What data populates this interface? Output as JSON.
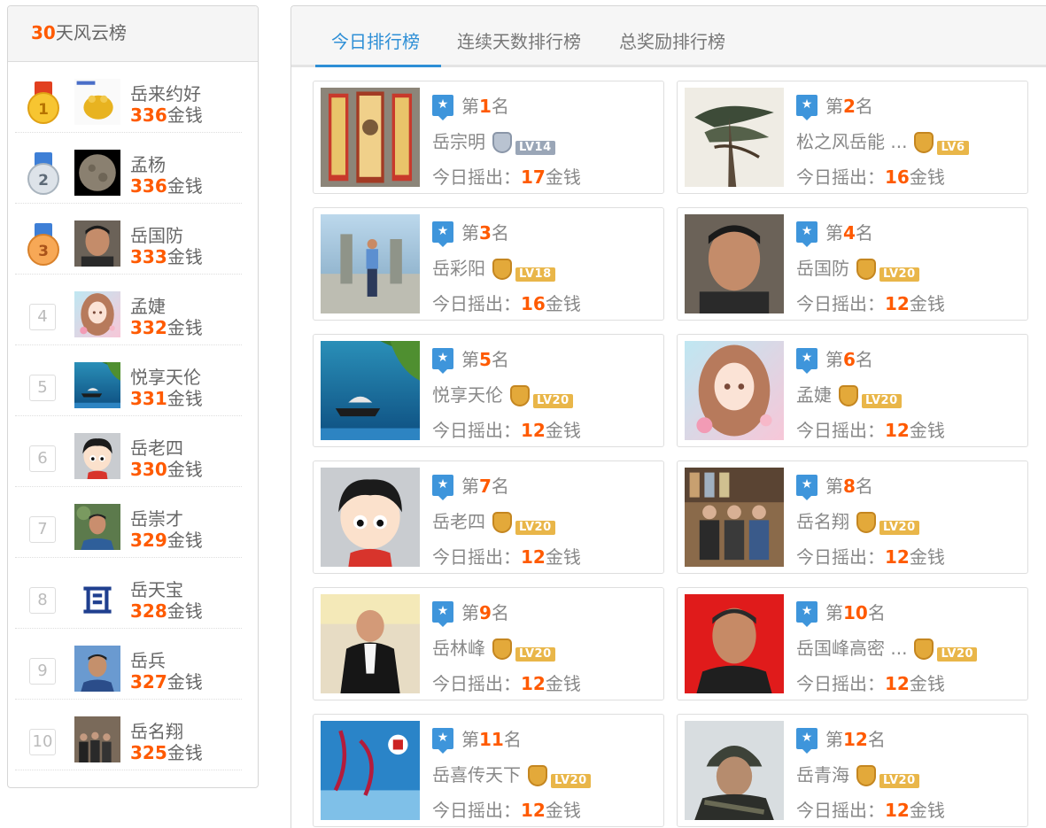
{
  "left": {
    "header_days": "30",
    "header_title": "天风云榜",
    "coin_unit": "金钱",
    "items": [
      {
        "rank": "1",
        "name": "岳来约好",
        "coins": "336"
      },
      {
        "rank": "2",
        "name": "孟杨",
        "coins": "336"
      },
      {
        "rank": "3",
        "name": "岳国防",
        "coins": "333"
      },
      {
        "rank": "4",
        "name": "孟婕",
        "coins": "332"
      },
      {
        "rank": "5",
        "name": "悦享天伦",
        "coins": "331"
      },
      {
        "rank": "6",
        "name": "岳老四",
        "coins": "330"
      },
      {
        "rank": "7",
        "name": "岳崇才",
        "coins": "329"
      },
      {
        "rank": "8",
        "name": "岳天宝",
        "coins": "328"
      },
      {
        "rank": "9",
        "name": "岳兵",
        "coins": "327"
      },
      {
        "rank": "10",
        "name": "岳名翔",
        "coins": "325"
      }
    ]
  },
  "tabs": [
    {
      "label": "今日排行榜",
      "active": true
    },
    {
      "label": "连续天数排行榜",
      "active": false
    },
    {
      "label": "总奖励排行榜",
      "active": false
    }
  ],
  "cards": {
    "rank_prefix": "第",
    "rank_suffix": "名",
    "today_label": "今日摇出：",
    "coin_unit": "金钱",
    "items": [
      {
        "rank": "1",
        "name": "岳宗明",
        "level": "LV14",
        "today": "17"
      },
      {
        "rank": "2",
        "name": "松之风岳能 ...",
        "level": "LV6",
        "today": "16"
      },
      {
        "rank": "3",
        "name": "岳彩阳",
        "level": "LV18",
        "today": "16"
      },
      {
        "rank": "4",
        "name": "岳国防",
        "level": "LV20",
        "today": "12"
      },
      {
        "rank": "5",
        "name": "悦享天伦",
        "level": "LV20",
        "today": "12"
      },
      {
        "rank": "6",
        "name": "孟婕",
        "level": "LV20",
        "today": "12"
      },
      {
        "rank": "7",
        "name": "岳老四",
        "level": "LV20",
        "today": "12"
      },
      {
        "rank": "8",
        "name": "岳名翔",
        "level": "LV20",
        "today": "12"
      },
      {
        "rank": "9",
        "name": "岳林峰",
        "level": "LV20",
        "today": "12"
      },
      {
        "rank": "10",
        "name": "岳国峰高密 ...",
        "level": "LV20",
        "today": "12"
      },
      {
        "rank": "11",
        "name": "岳喜传天下",
        "level": "LV20",
        "today": "12"
      },
      {
        "rank": "12",
        "name": "岳青海",
        "level": "LV20",
        "today": "12"
      }
    ]
  }
}
